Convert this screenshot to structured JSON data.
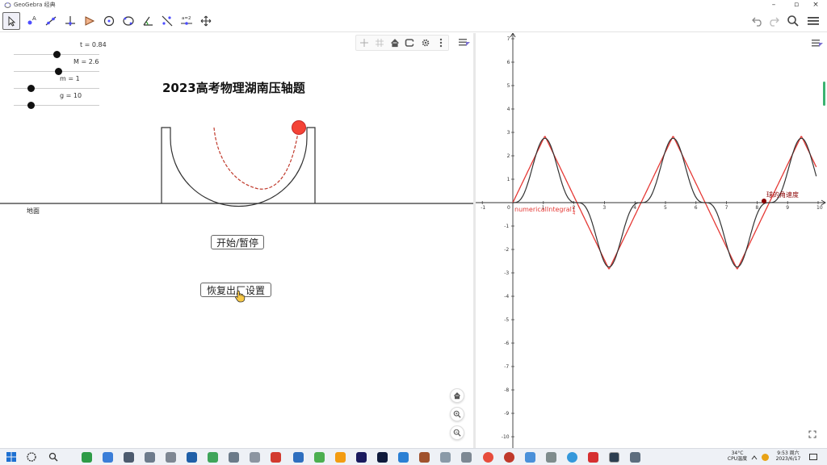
{
  "window": {
    "title": "GeoGebra 经典"
  },
  "sliders": [
    {
      "name": "t",
      "label": "t = 0.84",
      "fraction": 0.5
    },
    {
      "name": "M",
      "label": "M = 2.6",
      "fraction": 0.52
    },
    {
      "name": "m",
      "label": "m = 1",
      "fraction": 0.2
    },
    {
      "name": "g",
      "label": "g = 10",
      "fraction": 0.2
    }
  ],
  "view1": {
    "heading": "2023高考物理湖南压轴题",
    "ground_label": "地面",
    "start_pause_button": "开始/暂停",
    "reset_button": "恢复出厂设置",
    "colors": {
      "ball": "#f44336",
      "trajectory": "#c0392b",
      "track": "#333333"
    }
  },
  "view2": {
    "xaxis_ticks": [
      "-1",
      "0",
      "1",
      "2",
      "3",
      "4",
      "5",
      "6",
      "7",
      "8",
      "9",
      "10"
    ],
    "yaxis_ticks": [
      "7",
      "6",
      "5",
      "4",
      "3",
      "2",
      "1",
      "-1",
      "-2",
      "-3",
      "-4",
      "-5",
      "-6",
      "-7",
      "-8",
      "-9",
      "-10"
    ],
    "curve_label": "numericalIntegral1",
    "curve_subscript": "4",
    "point_label": "球的角速度",
    "colors": {
      "red_curve": "#e53935",
      "black_curve": "#333333"
    }
  },
  "taskbar": {
    "temperature": "34°C",
    "cpu": "CPU温度",
    "time": "9:53 周六",
    "date": "2023/6/17"
  }
}
